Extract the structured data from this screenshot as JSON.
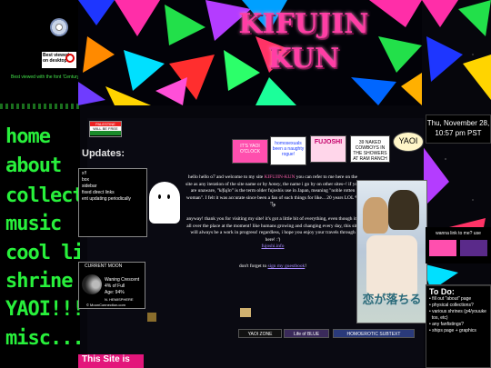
{
  "sidebar": {
    "best_viewed_badge": "Best viewed on desktop",
    "font_note": "Best viewed with the font 'Century G",
    "nav": [
      "home",
      "about",
      "collect",
      "music",
      "cool li",
      "shrine",
      "YAOI!!!",
      "misc..."
    ]
  },
  "header": {
    "logo_line1": "KIFUJIN",
    "logo_line2": "KUN"
  },
  "datetime": {
    "date": "Thu, November 28,",
    "time": "10:57 pm PST"
  },
  "palestine_banner": {
    "line1": "PALESTINE",
    "line2": "WILL BE FREE"
  },
  "updates": {
    "title": "Updates:",
    "lines": [
      "x!!",
      "box",
      "sidebar",
      "fixed direct links",
      "ent updating periodically"
    ]
  },
  "stamps": [
    {
      "text": "IT'S YAOI O'CLOCK",
      "bg": "#ff4fae"
    },
    {
      "text": "homosexuals been a naughty rogue!",
      "bg": "#ffffff"
    },
    {
      "text": "FUJOSHI",
      "bg": "#ffd6ea"
    },
    {
      "text": "39 NAKED COWBOYS IN THE SHOWERS AT RAM RANCH",
      "bg": "#ffffff"
    },
    {
      "text": "YAOI",
      "bg": "#fff6c8"
    }
  ],
  "welcome": {
    "intro": "hello hello o7 and welcome to my site",
    "site_name": "KIFUJIN-KUN",
    "p1a": "you can refer to me here on the site as any iteration of the site name or by",
    "alias": "honey",
    "p1b": "the name i go by on other sites~! if you are unaware,",
    "term": "\"kifujin\"",
    "p1c": "is the term older fujoshis use in Japan, meaning \"noble rotten woman\". I felt it was accurate since been a fan of such things for like... 20 years LOL",
    "emoticon": "٩( ̃ᵕ̃)و",
    "p2": "anyway! thank you for visiting my site! it's got a little bit of everything, even though it's all over the place at the moment! like humans growing and changing every day, this site will always be a work in progress! regardless, i hope you enjoy your travels through here! :')",
    "fujoshi_link": "fujoshi.info",
    "guestbook_pre": "don't forget to",
    "guestbook_link": "sign my guestbook",
    "guestbook_post": "!"
  },
  "moon": {
    "title": "CURRENT MOON",
    "phase": "Waning Crescent",
    "full": "4% of Full",
    "age": "Age: 94%",
    "hemisphere": "N. HEMISPHERE",
    "credit": "© MoonConnection.com"
  },
  "link_to_me": "wanna link to me? use",
  "todo": {
    "title": "To Do:",
    "items": [
      "fill out \"about\" page",
      "physical collections?",
      "various shrines (p4/youuke",
      "tos, etc)",
      "any fanfistings?",
      "ships page + graphics"
    ]
  },
  "footer_buttons": [
    "YAOI ZONE",
    "Life of BLUE",
    "HOMOEROTIC SUBTEXT"
  ],
  "bottom_title": "This Site is",
  "cover_text": "恋が落ちる"
}
